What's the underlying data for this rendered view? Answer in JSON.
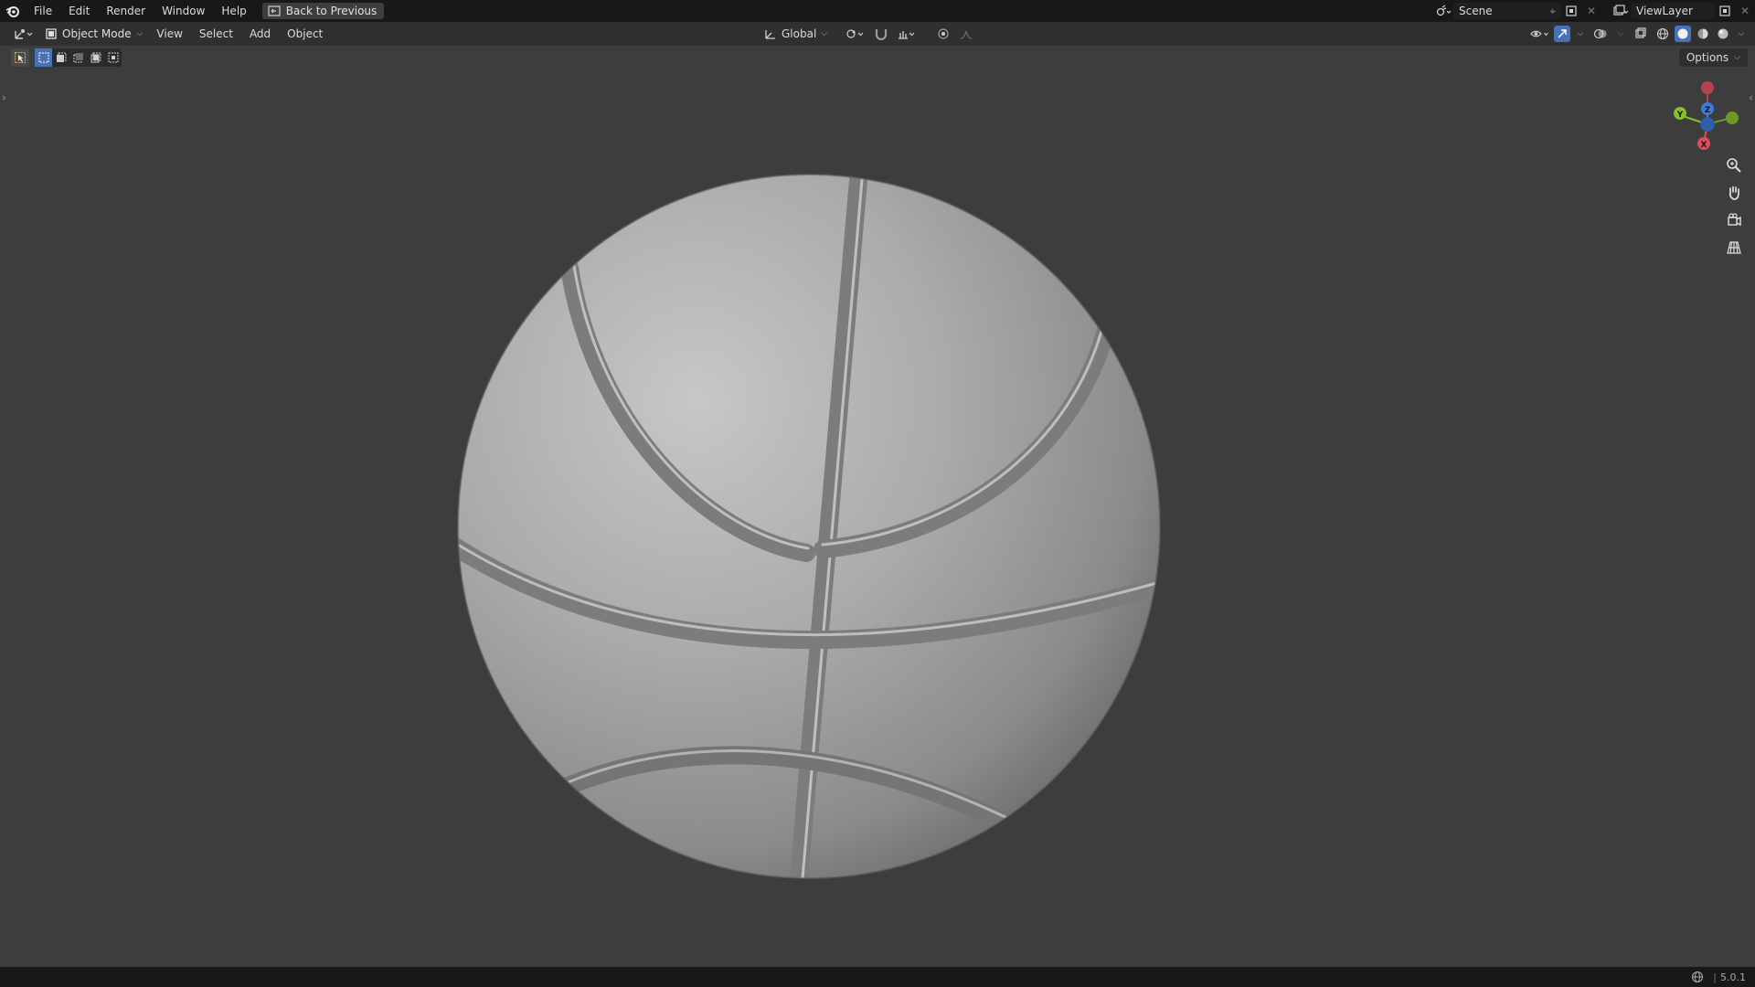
{
  "menu": {
    "items": [
      "File",
      "Edit",
      "Render",
      "Window",
      "Help"
    ],
    "back_button": "Back to Previous"
  },
  "top_right": {
    "scene_name": "Scene",
    "view_layer": "ViewLayer"
  },
  "header": {
    "mode": "Object Mode",
    "menus": [
      "View",
      "Select",
      "Add",
      "Object"
    ],
    "orientation": "Global",
    "options_label": "Options"
  },
  "status": {
    "version": "5.0.1"
  },
  "colors": {
    "active_blue": "#4772b3",
    "axis_x": "#e04c5b",
    "axis_y": "#86c02a",
    "axis_z": "#3d7be0"
  }
}
